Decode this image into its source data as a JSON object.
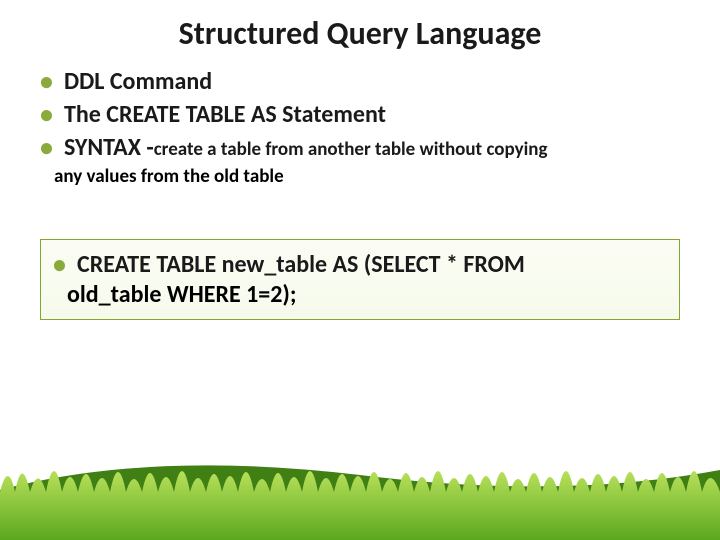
{
  "title": "Structured Query Language",
  "bullets": {
    "b1": "DDL  Command",
    "b2": "The CREATE TABLE AS Statement",
    "b3_prefix": "SYNTAX -",
    "b3_sub": "create a table from another table without copying",
    "b3_cont": "any values from the old table"
  },
  "code": {
    "line1": "CREATE TABLE new_table AS (SELECT * FROM",
    "line2": "old_table WHERE 1=2);"
  }
}
